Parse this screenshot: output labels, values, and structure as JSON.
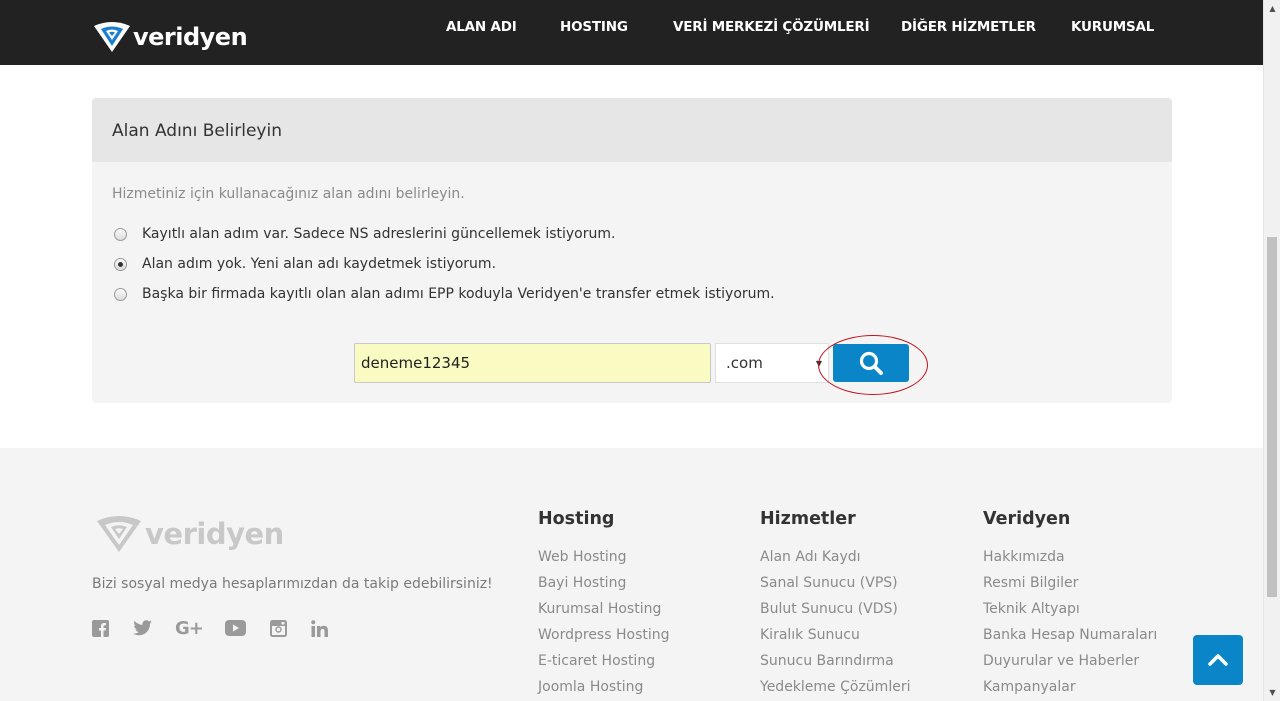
{
  "header": {
    "brand": "veridyen",
    "nav": [
      "ALAN ADI",
      "HOSTING",
      "VERİ MERKEZİ ÇÖZÜMLERİ",
      "DİĞER HİZMETLER",
      "KURUMSAL"
    ]
  },
  "panel": {
    "title": "Alan Adını Belirleyin",
    "description": "Hizmetiniz için kullanacağınız alan adını belirleyin.",
    "options": [
      {
        "label": "Kayıtlı alan adım var. Sadece NS adreslerini güncellemek istiyorum.",
        "checked": false
      },
      {
        "label": "Alan adım yok. Yeni alan adı kaydetmek istiyorum.",
        "checked": true
      },
      {
        "label": "Başka bir firmada kayıtlı olan alan adımı EPP koduyla Veridyen'e transfer etmek istiyorum.",
        "checked": false
      }
    ],
    "domain_value": "deneme12345",
    "tld_value": ".com",
    "search_icon": "search-icon"
  },
  "footer": {
    "brand": "veridyen",
    "follow_text": "Bizi sosyal medya hesaplarımızdan da takip edebilirsiniz!",
    "social_icons": [
      "facebook-icon",
      "twitter-icon",
      "google-plus-icon",
      "youtube-icon",
      "instagram-icon",
      "linkedin-icon"
    ],
    "columns": [
      {
        "title": "Hosting",
        "links": [
          "Web Hosting",
          "Bayi Hosting",
          "Kurumsal Hosting",
          "Wordpress Hosting",
          "E-ticaret Hosting",
          "Joomla Hosting"
        ]
      },
      {
        "title": "Hizmetler",
        "links": [
          "Alan Adı Kaydı",
          "Sanal Sunucu (VPS)",
          "Bulut Sunucu (VDS)",
          "Kiralık Sunucu",
          "Sunucu Barındırma",
          "Yedekleme Çözümleri"
        ]
      },
      {
        "title": "Veridyen",
        "links": [
          "Hakkımızda",
          "Resmi Bilgiler",
          "Teknik Altyapı",
          "Banka Hesap Numaraları",
          "Duyurular ve Haberler",
          "Kampanyalar"
        ]
      }
    ]
  },
  "colors": {
    "header_bg": "#222222",
    "accent": "#0a86c8",
    "input_bg": "#fafbc3",
    "highlight": "#c0121b"
  }
}
